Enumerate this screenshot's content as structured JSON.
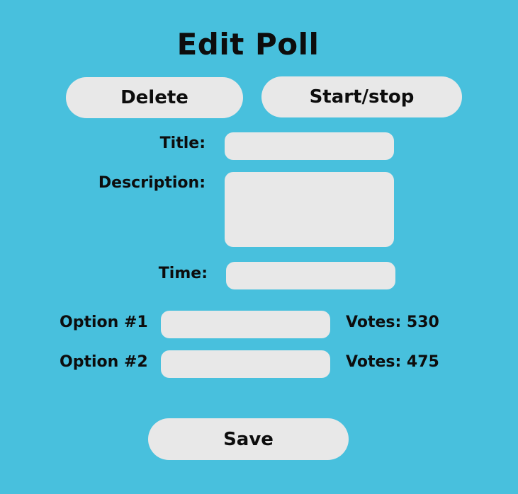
{
  "page": {
    "title": "Edit Poll"
  },
  "actions": {
    "delete_label": "Delete",
    "start_stop_label": "Start/stop",
    "save_label": "Save"
  },
  "form": {
    "title_label": "Title:",
    "title_value": "",
    "description_label": "Description:",
    "description_value": "",
    "time_label": "Time:",
    "time_value": ""
  },
  "options": [
    {
      "label": "Option #1",
      "value": "",
      "votes_text": "Votes: 530",
      "votes": 530
    },
    {
      "label": "Option #2",
      "value": "",
      "votes_text": "Votes: 475",
      "votes": 475
    }
  ],
  "colors": {
    "background": "#48c0dd",
    "control": "#e8e8e8",
    "text": "#0d0d0d"
  }
}
